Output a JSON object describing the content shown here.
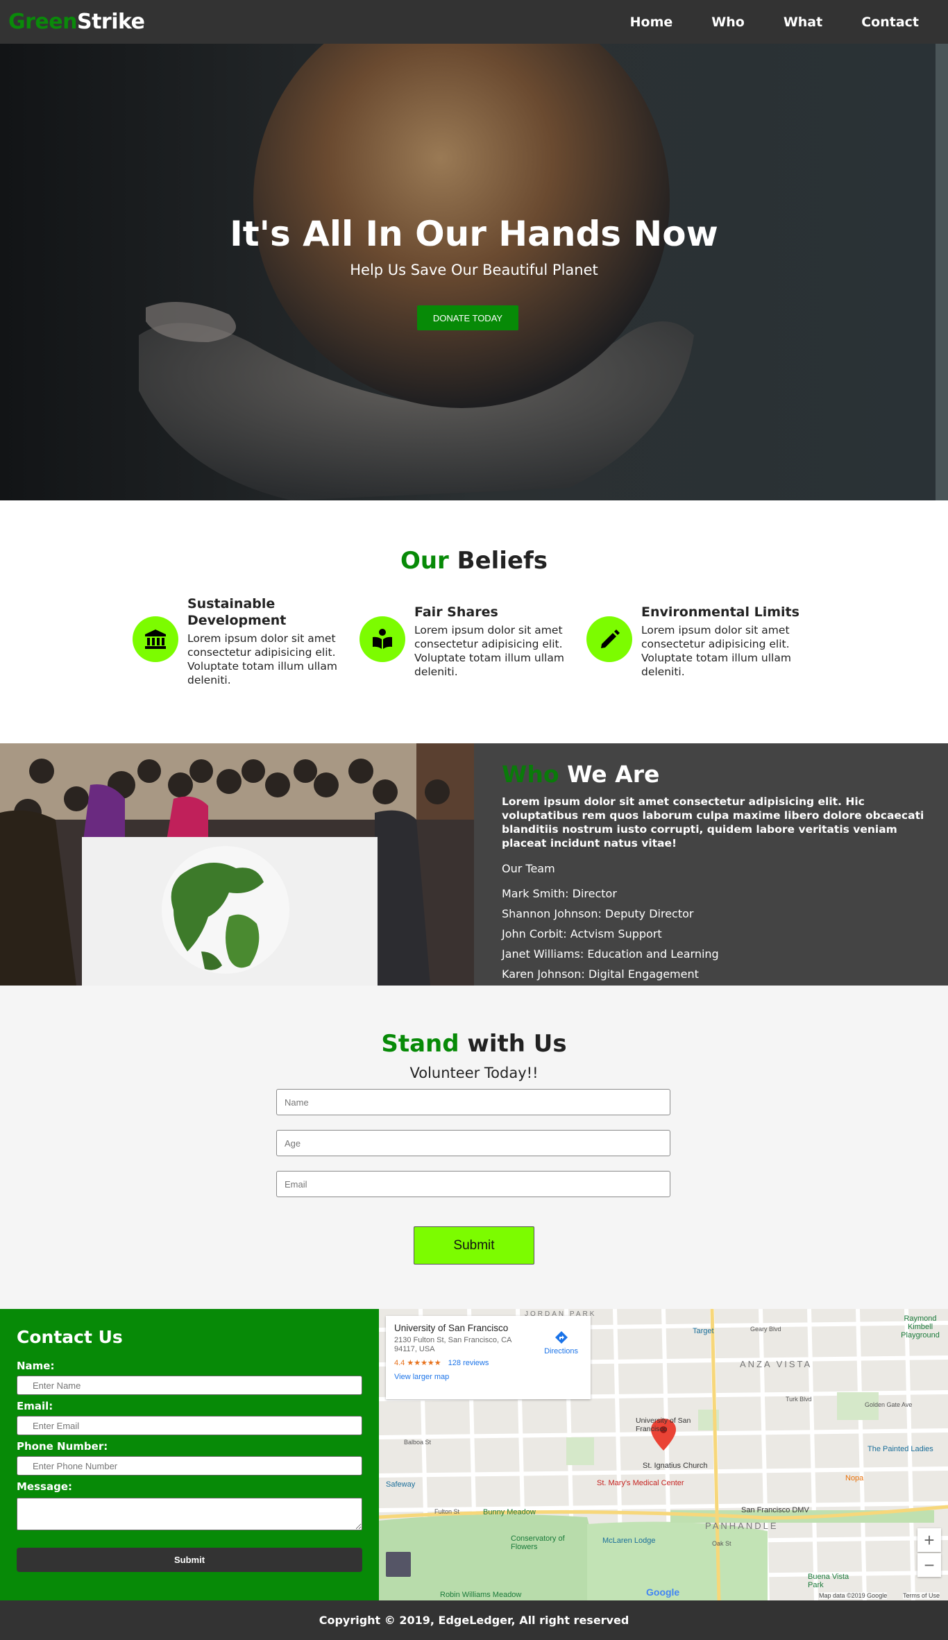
{
  "brand": {
    "green": "Green",
    "strike": "Strike"
  },
  "nav": {
    "items": [
      {
        "label": "Home"
      },
      {
        "label": "Who"
      },
      {
        "label": "What"
      },
      {
        "label": "Contact"
      }
    ]
  },
  "hero": {
    "title": "It's All In Our Hands Now",
    "subtitle": "Help Us Save Our Beautiful Planet",
    "button": "DONATE TODAY"
  },
  "beliefs": {
    "title_green": "Our",
    "title_rest": " Beliefs",
    "items": [
      {
        "title": "Sustainable Development",
        "text": "Lorem ipsum dolor sit amet consectetur adipisicing elit. Voluptate totam illum ullam deleniti.",
        "icon": "bank-icon"
      },
      {
        "title": "Fair Shares",
        "text": "Lorem ipsum dolor sit amet consectetur adipisicing elit. Voluptate totam illum ullam deleniti.",
        "icon": "book-reader-icon"
      },
      {
        "title": "Environmental Limits",
        "text": "Lorem ipsum dolor sit amet consectetur adipisicing elit. Voluptate totam illum ullam deleniti.",
        "icon": "pencil-icon"
      }
    ]
  },
  "who": {
    "title_green": "Who",
    "title_rest": " We Are",
    "lead": "Lorem ipsum dolor sit amet consectetur adipisicing elit. Hic voluptatibus rem quos laborum culpa maxime libero dolore obcaecati blanditiis nostrum iusto corrupti, quidem labore veritatis veniam placeat incidunt natus vitae!",
    "team_heading": "Our Team",
    "members": [
      "Mark Smith: Director",
      "Shannon Johnson: Deputy Director",
      "John Corbit: Actvism Support",
      "Janet Williams: Education and Learning",
      "Karen Johnson: Digital Engagement"
    ]
  },
  "stand": {
    "title_green": "Stand",
    "title_rest": " with Us",
    "subtitle": "Volunteer Today!!",
    "fields": [
      {
        "placeholder": "Name"
      },
      {
        "placeholder": "Age"
      },
      {
        "placeholder": "Email"
      }
    ],
    "submit": "Submit"
  },
  "contact": {
    "title": "Contact Us",
    "name_label": "Name:",
    "name_placeholder": "Enter Name",
    "email_label": "Email:",
    "email_placeholder": "Enter Email",
    "phone_label": "Phone Number:",
    "phone_placeholder": "Enter Phone Number",
    "message_label": "Message:",
    "submit": "Submit"
  },
  "map": {
    "place": "University of San Francisco",
    "address": "2130 Fulton St, San Francisco, CA 94117, USA",
    "rating": "4.4 ★★★★★",
    "reviews": "128 reviews",
    "larger": "View larger map",
    "directions": "Directions",
    "labels": {
      "jordan": "JORDAN PARK",
      "anza": "ANZA VISTA",
      "panhandle": "PANHANDLE",
      "usf": "University of San Francisco",
      "ignatius": "St. Ignatius Church",
      "stmary": "St. Mary's Medical Center",
      "bunny": "Bunny Meadow",
      "conservatory": "Conservatory of Flowers",
      "mclaren": "McLaren Lodge",
      "sfdmv": "San Francisco DMV",
      "painted": "The Painted Ladies",
      "target": "Target",
      "safeway": "Safeway",
      "raymond": "Raymond Kimbell Playground",
      "nopa": "Nopa",
      "buena": "Buena Vista Park",
      "robin": "Robin Williams Meadow",
      "geary": "Geary Blvd",
      "fulton": "Fulton St",
      "oak": "Oak St",
      "balboa": "Balboa St",
      "turk": "Turk Blvd",
      "golden": "Golden Gate Ave",
      "google": "Google",
      "data": "Map data ©2019 Google",
      "terms": "Terms of Use"
    }
  },
  "footer": {
    "text": "Copyright © 2019, EdgeLedger, All right reserved"
  }
}
